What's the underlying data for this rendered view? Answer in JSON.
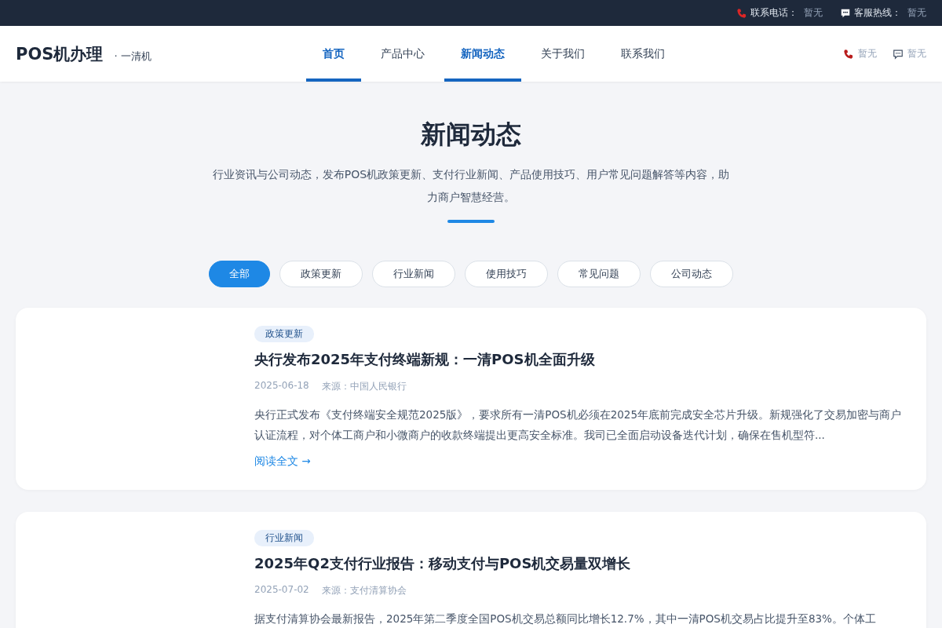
{
  "top_bar": {
    "contacts": [
      {
        "kind": "phone",
        "label": "联系电话：",
        "value": "暂无"
      },
      {
        "kind": "chat",
        "label": "客服热线：",
        "value": "暂无"
      }
    ]
  },
  "header": {
    "logo": "POS机办理",
    "tagline": "· 一清机",
    "nav": [
      {
        "label": "首页",
        "selected": true
      },
      {
        "label": "产品中心",
        "selected": false
      },
      {
        "label": "新闻动态",
        "selected": true
      },
      {
        "label": "关于我们",
        "selected": false
      },
      {
        "label": "联系我们",
        "selected": false
      }
    ],
    "actions": [
      {
        "kind": "phone",
        "label": "暂无"
      },
      {
        "kind": "chat",
        "label": "暂无"
      }
    ]
  },
  "hero": {
    "title": "新闻动态",
    "subtitle": "行业资讯与公司动态，发布POS机政策更新、支付行业新闻、产品使用技巧、用户常见问题解答等内容，助力商户智慧经营。"
  },
  "filters": [
    {
      "label": "全部",
      "selected": true
    },
    {
      "label": "政策更新",
      "selected": false
    },
    {
      "label": "行业新闻",
      "selected": false
    },
    {
      "label": "使用技巧",
      "selected": false
    },
    {
      "label": "常见问题",
      "selected": false
    },
    {
      "label": "公司动态",
      "selected": false
    }
  ],
  "articles": [
    {
      "tag": "政策更新",
      "title": "央行发布2025年支付终端新规：一清POS机全面升级",
      "date": "2025-06-18",
      "source": "来源：中国人民银行",
      "excerpt": "央行正式发布《支付终端安全规范2025版》，要求所有一清POS机必须在2025年底前完成安全芯片升级。新规强化了交易加密与商户认证流程，对个体工商户和小微商户的收款终端提出更高安全标准。我司已全面启动设备迭代计划，确保在售机型符...",
      "link": "阅读全文 →"
    },
    {
      "tag": "行业新闻",
      "title": "2025年Q2支付行业报告：移动支付与POS机交易量双增长",
      "date": "2025-07-02",
      "source": "来源：支付清算协会",
      "excerpt": "据支付清算协会最新报告，2025年第二季度全国POS机交易总额同比增长12.7%，其中一清POS机交易占比提升至83%。个体工"
    }
  ]
}
